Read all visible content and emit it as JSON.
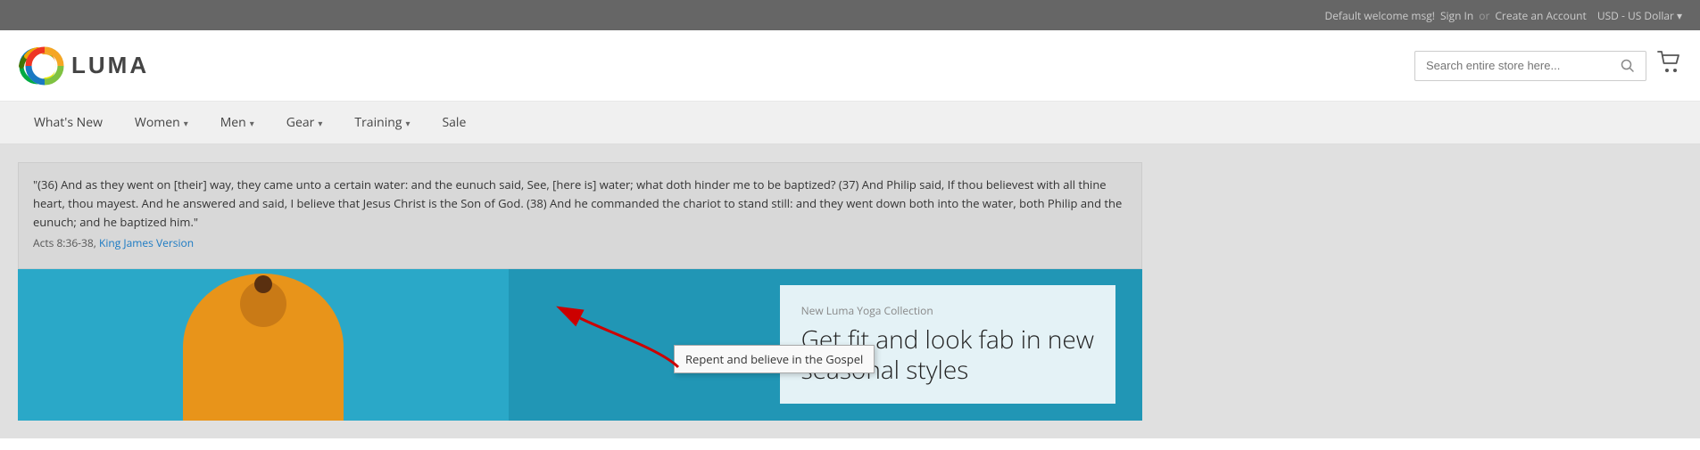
{
  "topbar": {
    "welcome_msg": "Default welcome msg!",
    "signin_label": "Sign In",
    "or_text": "or",
    "create_account_label": "Create an Account",
    "currency_label": "USD - US Dollar",
    "currency_arrow": "▾"
  },
  "header": {
    "logo_text": "LUMA",
    "search_placeholder": "Search entire store here...",
    "cart_icon": "🛒"
  },
  "nav": {
    "items": [
      {
        "label": "What's New",
        "has_dropdown": false
      },
      {
        "label": "Women",
        "has_dropdown": true
      },
      {
        "label": "Men",
        "has_dropdown": true
      },
      {
        "label": "Gear",
        "has_dropdown": true
      },
      {
        "label": "Training",
        "has_dropdown": true
      },
      {
        "label": "Sale",
        "has_dropdown": false
      }
    ]
  },
  "verse": {
    "text": "\"(36) And as they went on [their] way, they came unto a certain water: and the eunuch said, See, [here is] water; what doth hinder me to be baptized? (37) And Philip said, If thou believest with all thine heart, thou mayest. And he answered and said, I believe that Jesus Christ is the Son of God. (38) And he commanded the chariot to stand still: and they went down both into the water, both Philip and the eunuch; and he baptized him.\"",
    "ref_text": "Acts 8:36-38,",
    "ref_link_text": "King James Version",
    "ref_link_url": "#"
  },
  "tooltip": {
    "text": "Repent and believe in the Gospel"
  },
  "hero": {
    "card_subtitle": "New Luma Yoga Collection",
    "card_title_line1": "Get fit and look fab in new",
    "card_title_line2": "seasonal styles"
  }
}
